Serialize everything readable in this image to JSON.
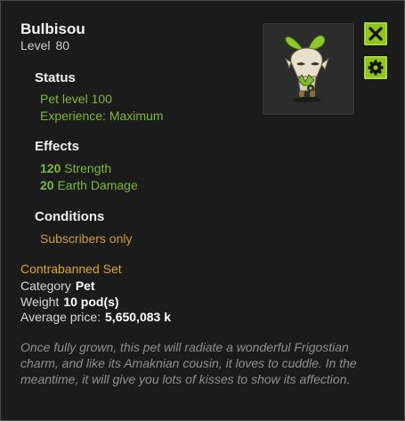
{
  "item": {
    "name": "Bulbisou",
    "level_label": "Level",
    "level_value": "80"
  },
  "status": {
    "heading": "Status",
    "lines": [
      "Pet level 100",
      "Experience: Maximum"
    ]
  },
  "effects": {
    "heading": "Effects",
    "lines": [
      {
        "value": "120",
        "label": "Strength"
      },
      {
        "value": "20",
        "label": "Earth Damage"
      }
    ]
  },
  "conditions": {
    "heading": "Conditions",
    "lines": [
      "Subscribers only"
    ]
  },
  "set_name": "Contrabanned Set",
  "details": {
    "category_label": "Category",
    "category_value": "Pet",
    "weight_label": "Weight",
    "weight_value": "10 pod(s)",
    "price_label": "Average price:",
    "price_value": "5,650,083 k"
  },
  "description": "Once fully grown, this pet will radiate a wonderful Frigostian charm, and like its Amaknian cousin, it loves to cuddle. In the meantime, it will give you lots of kisses to show its affection.",
  "icons": {
    "close": "close-icon",
    "settings": "gear-icon",
    "item": "bulbisou-pet-image"
  },
  "colors": {
    "accent_button": "#8fc31f",
    "effect_green": "#7dba3a",
    "condition_orange": "#d19a3e",
    "set_gold": "#e0a526"
  }
}
